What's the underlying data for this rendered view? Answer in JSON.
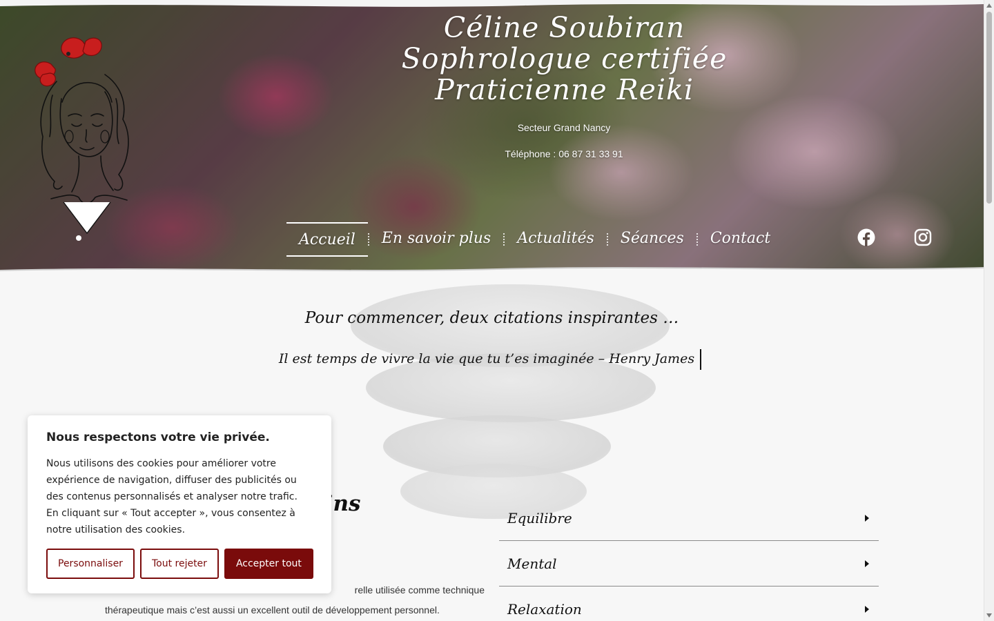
{
  "header": {
    "title_line1": "Céline Soubiran",
    "title_line2": "Sophrologue certifiée",
    "title_line3": "Praticienne Reiki",
    "sector": "Secteur Grand Nancy",
    "phone": "Téléphone : 06 87 31 33 91"
  },
  "nav": {
    "items": [
      {
        "label": "Accueil",
        "active": true
      },
      {
        "label": "En savoir plus"
      },
      {
        "label": "Actualités"
      },
      {
        "label": "Séances"
      },
      {
        "label": "Contact"
      }
    ]
  },
  "social": {
    "facebook": "facebook-icon",
    "instagram": "instagram-icon"
  },
  "quotes": {
    "title": "Pour commencer, deux citations inspirantes …",
    "current": "Il est temps de vivre la vie que tu t’es imaginée – Henry James"
  },
  "section": {
    "heading_visible": "oins",
    "body_line1": "relle utilisée comme technique",
    "body_line2": "thérapeutique mais c’est aussi un excellent outil de développement personnel."
  },
  "accordion": {
    "items": [
      {
        "label": "Equilibre"
      },
      {
        "label": "Mental"
      },
      {
        "label": "Relaxation"
      }
    ]
  },
  "cookie": {
    "title": "Nous respectons votre vie privée.",
    "text": "Nous utilisons des cookies pour améliorer votre expérience de navigation, diffuser des publicités ou des contenus personnalisés et analyser notre trafic. En cliquant sur « Tout accepter », vous consentez à notre utilisation des cookies.",
    "customize": "Personnaliser",
    "reject": "Tout rejeter",
    "accept": "Accepter tout"
  },
  "colors": {
    "accent": "#7a0b0b",
    "poppy": "#c81e1e"
  }
}
